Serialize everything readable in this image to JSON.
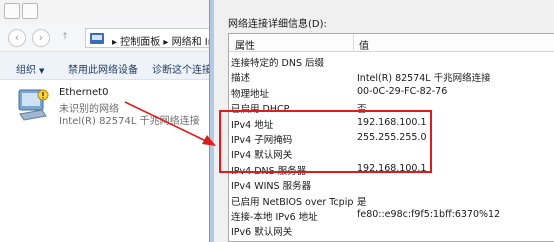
{
  "explorer": {
    "address": {
      "path_root": "控制面板",
      "path_next": "网络和 In"
    },
    "commands": {
      "organize": "组织",
      "disable": "禁用此网络设备",
      "diagnose": "诊断这个连接"
    },
    "adapter": {
      "name": "Ethernet0",
      "status": "未识别的网络",
      "device": "Intel(R) 82574L 千兆网络连接"
    }
  },
  "dialog": {
    "label": "网络连接详细信息(D):",
    "columns": {
      "property": "属性",
      "value": "值"
    },
    "rows": [
      {
        "property": "连接特定的 DNS 后缀",
        "value": ""
      },
      {
        "property": "描述",
        "value": "Intel(R) 82574L 千兆网络连接"
      },
      {
        "property": "物理地址",
        "value": "00-0C-29-FC-82-76"
      },
      {
        "property": "已启用 DHCP",
        "value": "否"
      },
      {
        "property": "IPv4 地址",
        "value": "192.168.100.1"
      },
      {
        "property": "IPv4 子网掩码",
        "value": "255.255.255.0"
      },
      {
        "property": "IPv4 默认网关",
        "value": ""
      },
      {
        "property": "IPv4 DNS 服务器",
        "value": "192.168.100.1"
      },
      {
        "property": "IPv4 WINS 服务器",
        "value": ""
      },
      {
        "property": "已启用 NetBIOS over Tcpip",
        "value": "是"
      },
      {
        "property": "连接-本地 IPv6 地址",
        "value": "fe80::e98c:f9f5:1bff:6370%12"
      },
      {
        "property": "IPv6 默认网关",
        "value": ""
      },
      {
        "property": "IPv6 DNS 服务器",
        "value": ""
      }
    ]
  },
  "colors": {
    "highlight": "#e01b1b",
    "command_text": "#1e395b",
    "status_text": "#6d6d6d"
  }
}
